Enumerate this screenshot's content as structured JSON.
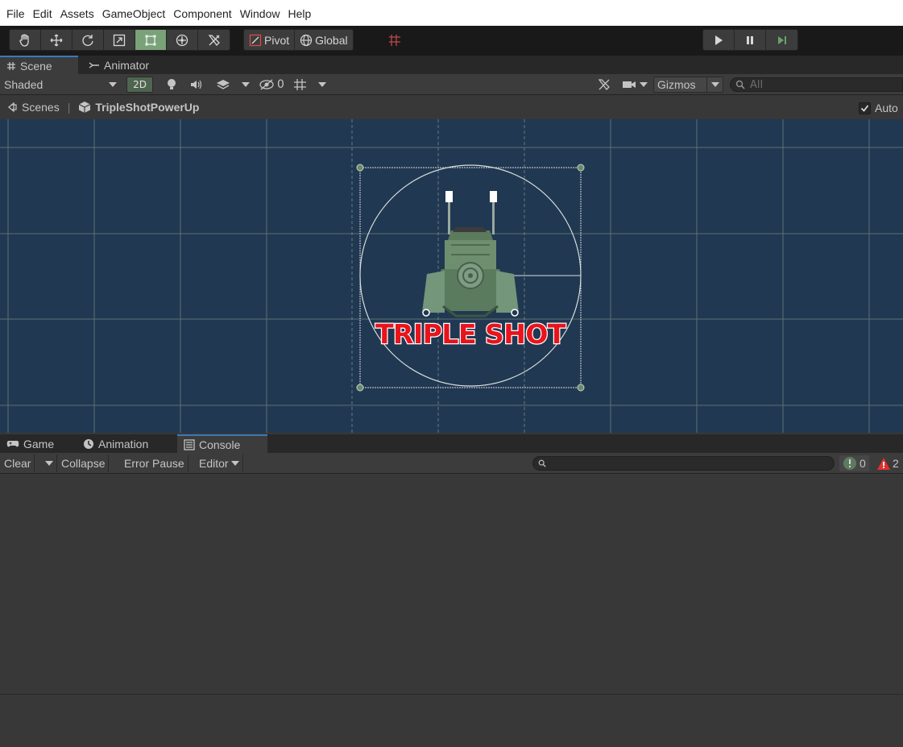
{
  "menu": [
    "File",
    "Edit",
    "Assets",
    "GameObject",
    "Component",
    "Window",
    "Help"
  ],
  "toolbar": {
    "tools": [
      {
        "name": "hand-tool",
        "icon": "hand-icon"
      },
      {
        "name": "move-tool",
        "icon": "move-icon"
      },
      {
        "name": "rotate-tool",
        "icon": "rotate-icon"
      },
      {
        "name": "scale-tool",
        "icon": "scale-icon"
      },
      {
        "name": "rect-tool",
        "icon": "rect-icon",
        "active": true
      },
      {
        "name": "transform-tool",
        "icon": "transform-icon"
      },
      {
        "name": "custom-tool",
        "icon": "tools-icon"
      }
    ],
    "pivot_label": "Pivot",
    "global_label": "Global"
  },
  "tabs": {
    "scene": "Scene",
    "animator": "Animator"
  },
  "scene_toolbar": {
    "shading_mode": "Shaded",
    "mode_2d": "2D",
    "hidden_count": "0",
    "gizmos_label": "Gizmos",
    "search_placeholder": "All"
  },
  "breadcrumb": {
    "root": "Scenes",
    "prefab": "TripleShotPowerUp"
  },
  "auto_save": {
    "label": "Auto",
    "checked": true
  },
  "scene": {
    "sprite_text": "TRIPLE SHOT",
    "grid_color": "#8aa78a",
    "background_color": "#213853",
    "text_color": "#e8141c"
  },
  "bottom_tabs": {
    "game": "Game",
    "animation": "Animation",
    "console": "Console"
  },
  "console_toolbar": {
    "clear": "Clear",
    "collapse": "Collapse",
    "error_pause": "Error Pause",
    "editor": "Editor",
    "info_count": "0",
    "warning_count": "2"
  }
}
